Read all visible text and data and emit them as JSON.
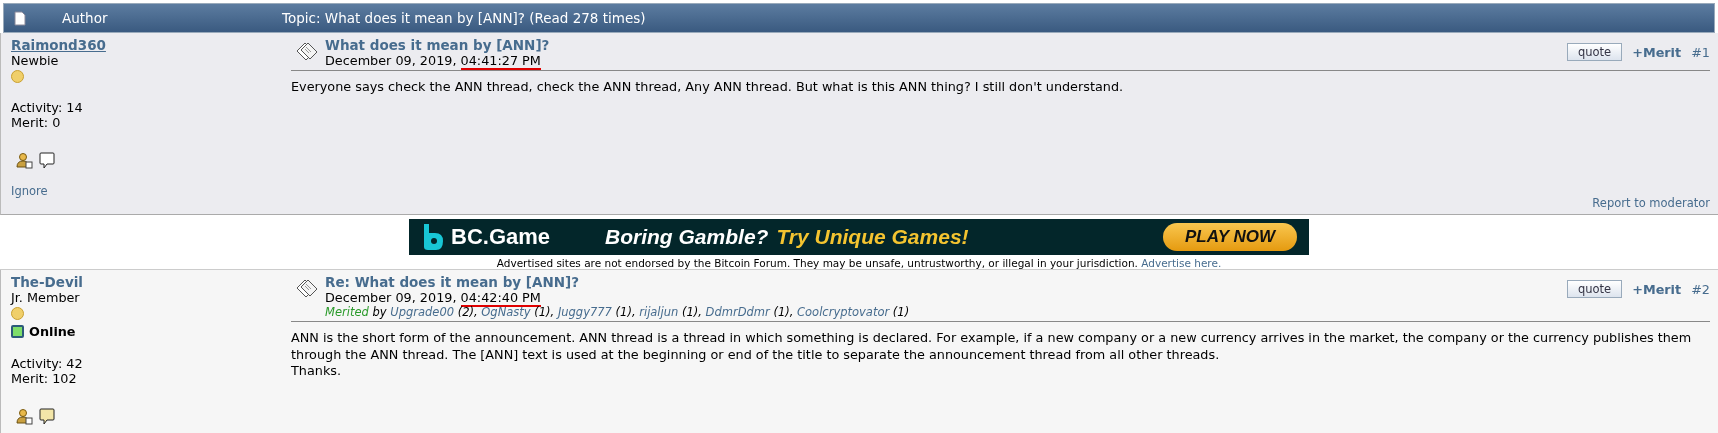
{
  "header": {
    "author_label": "Author",
    "topic": "Topic: What does it mean by [ANN]?  (Read 278 times)"
  },
  "posts": [
    {
      "author": {
        "name": "Raimond360",
        "underlined": true,
        "rank": "Newbie",
        "online": false,
        "activity": "Activity: 14",
        "merit": "Merit: 0",
        "ignore": "Ignore"
      },
      "title": "What does it mean by [ANN]?",
      "date": "December 09, 2019, ",
      "time": "04:41:27 PM",
      "time_underlined": true,
      "quote": "quote",
      "merit_button": "+Merit",
      "number": "#1",
      "body": [
        "Everyone says check the ANN thread, check the ANN thread, Any ANN thread. But what is this ANN thing? I still don't understand."
      ],
      "report": "Report to moderator"
    },
    {
      "author": {
        "name": "The-Devil",
        "underlined": false,
        "rank": "Jr. Member",
        "online": true,
        "online_label": "Online",
        "activity": "Activity: 42",
        "merit": "Merit: 102"
      },
      "title": "Re: What does it mean by [ANN]?",
      "date": "December 09, 2019, ",
      "time": "04:42:40 PM",
      "time_underlined": true,
      "merited": {
        "label": "Merited",
        "by": "by",
        "users": [
          {
            "name": "Upgrade00",
            "count": "(2),"
          },
          {
            "name": "OgNasty",
            "count": "(1),"
          },
          {
            "name": "Juggy777",
            "count": "(1),"
          },
          {
            "name": "rijaljun",
            "count": "(1),"
          },
          {
            "name": "DdmrDdmr",
            "count": "(1),"
          },
          {
            "name": "Coolcryptovator",
            "count": "(1)"
          }
        ]
      },
      "quote": "quote",
      "merit_button": "+Merit",
      "number": "#2",
      "body": [
        "ANN is the short form of the announcement. ANN thread is a thread in which something is declared. For example, if a new company or a new currency arrives in the market, the company or the currency publishes them through the ANN thread. The [ANN] text is used at the beginning or end of the title to separate the announcement thread from all other threads.",
        "Thanks."
      ]
    }
  ],
  "ad": {
    "brand": "BC.Game",
    "slogan_white": "Boring Gamble?",
    "slogan_yellow": "Try Unique Games!",
    "cta": "PLAY NOW",
    "disclaimer": "Advertised sites are not endorsed by the Bitcoin Forum. They may be unsafe, untrustworthy, or illegal in your jurisdiction.",
    "advertise_link": "Advertise here."
  }
}
